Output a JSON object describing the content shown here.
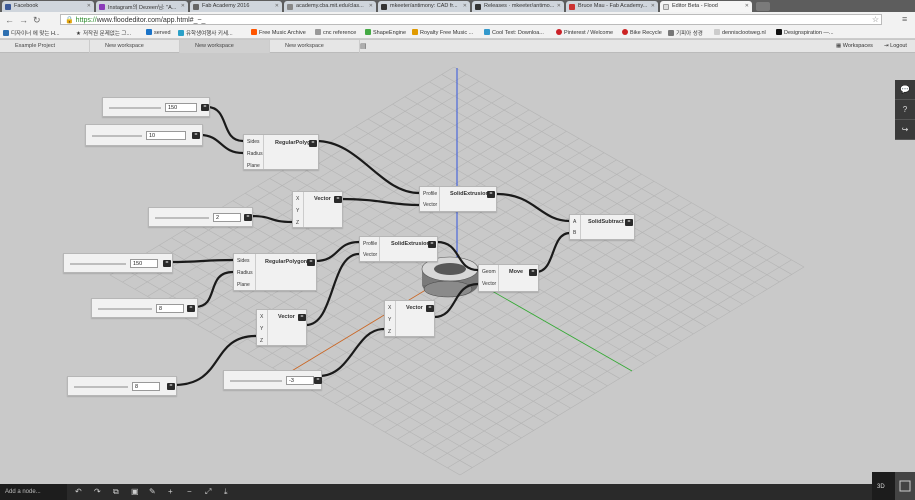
{
  "browser": {
    "tabs": [
      {
        "label": "Facebook",
        "color": "#3b5998",
        "active": false
      },
      {
        "label": "Instagram의 Dezeen님: \"A...",
        "color": "#8a3ab9",
        "active": false
      },
      {
        "label": "Fab Academy 2016",
        "color": "#666666",
        "active": false
      },
      {
        "label": "academy.cba.mit.edu/clas...",
        "color": "#888888",
        "active": false
      },
      {
        "label": "mkeeter/antimony: CAD fr...",
        "color": "#333333",
        "active": false
      },
      {
        "label": "Releases · mkeeter/antimo...",
        "color": "#333333",
        "active": false
      },
      {
        "label": "Bruce Mau - Fab Academy...",
        "color": "#cc3333",
        "active": false
      },
      {
        "label": "Editor Beta - Flood",
        "color": "#dddddd",
        "active": true
      }
    ],
    "url_scheme": "https://",
    "url_rest": "www.floodeditor.com/app.html#_~_",
    "bookmarks": [
      {
        "label": "디자이너 에 맞는 H...",
        "color": "#2d6fb0"
      },
      {
        "label": "저작권 문제없는 그...",
        "color": "#222222"
      },
      {
        "label": "served",
        "color": "#1a73c8"
      },
      {
        "label": "유학생여행사 키세...",
        "color": "#2aa0c8"
      },
      {
        "label": "Free Music Archive",
        "color": "#ff5500"
      },
      {
        "label": "cnc reference",
        "color": "#999999"
      },
      {
        "label": "ShapeEngine",
        "color": "#44aa44"
      },
      {
        "label": "Royalty Free Music ...",
        "color": "#e09a00"
      },
      {
        "label": "Cool Text: Downloa...",
        "color": "#3399cc"
      },
      {
        "label": "Pinterest / Welcome",
        "color": "#cb2027"
      },
      {
        "label": "Bike Recycle",
        "color": "#cc2222"
      },
      {
        "label": "기피아 성경",
        "color": "#777777"
      },
      {
        "label": "dennisclootweg.nl",
        "color": "#cccccc"
      },
      {
        "label": "Designspiration —...",
        "color": "#111111"
      }
    ]
  },
  "workspace_tabs": [
    "Example Project",
    "New workspace",
    "New workspace",
    "New workspace"
  ],
  "workspace_right": {
    "workspaces": "Workspaces",
    "logout": "Logout"
  },
  "nodes": {
    "regular_polygon_1": {
      "title": "RegularPolygon",
      "ports": [
        "Sides",
        "Radius",
        "Plane"
      ]
    },
    "vector_1": {
      "title": "Vector",
      "ports": [
        "X",
        "Y",
        "Z"
      ]
    },
    "solid_extrusion_1": {
      "title": "SolidExtrusion",
      "ports": [
        "Profile",
        "Vector"
      ]
    },
    "solid_subtract": {
      "title": "SolidSubtract",
      "ports": [
        "A",
        "B"
      ]
    },
    "regular_polygon_2": {
      "title": "RegularPolygon",
      "ports": [
        "Sides",
        "Radius",
        "Plane"
      ]
    },
    "solid_extrusion_2": {
      "title": "SolidExtrusion",
      "ports": [
        "Profile",
        "Vector"
      ]
    },
    "move": {
      "title": "Move",
      "ports": [
        "Geom",
        "Vector"
      ]
    },
    "vector_2": {
      "title": "Vector",
      "ports": [
        "X",
        "Y",
        "Z"
      ]
    },
    "vector_3": {
      "title": "Vector",
      "ports": [
        "X",
        "Y",
        "Z"
      ]
    }
  },
  "number_inputs": {
    "n1": {
      "value": "150",
      "level": 0.75
    },
    "n2": {
      "value": "10",
      "level": 0.3
    },
    "n3": {
      "value": "2",
      "level": 0.2
    },
    "n4": {
      "value": "150",
      "level": 0.75
    },
    "n5": {
      "value": "8",
      "level": 0.3
    },
    "n6": {
      "value": "8",
      "level": 0.5
    },
    "n7": {
      "value": "-3",
      "level": 0.35
    }
  },
  "bottom": {
    "add_node": "Add a node...",
    "mode": "3D"
  },
  "colors": {
    "axis_blue": "#3355dd",
    "axis_green": "#33aa33",
    "axis_orange": "#cc6622",
    "wire": "#1a1a1a"
  }
}
